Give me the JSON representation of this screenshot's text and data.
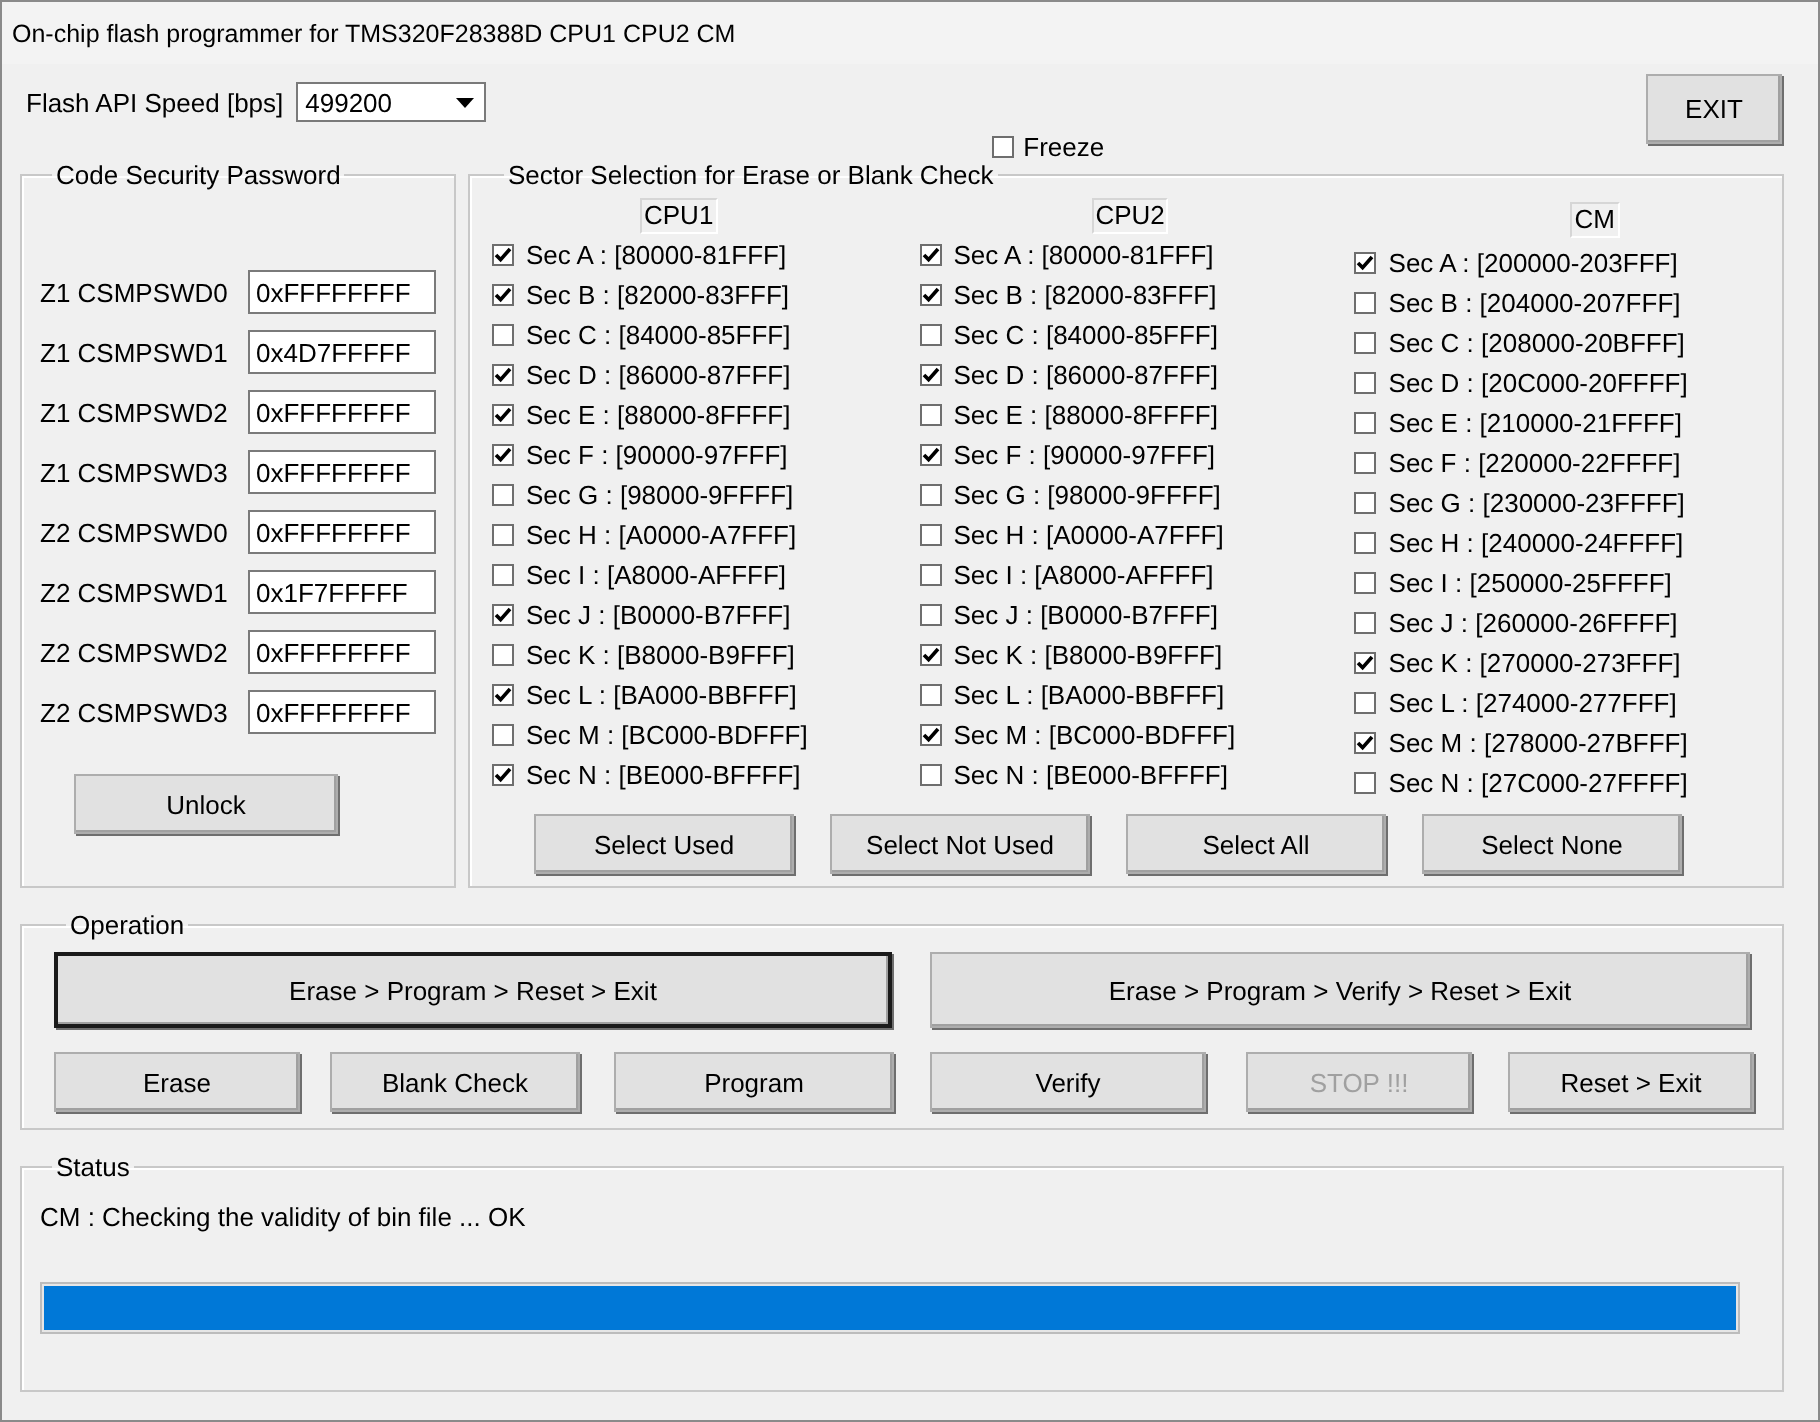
{
  "window": {
    "title": "On-chip flash programmer for TMS320F28388D CPU1 CPU2 CM"
  },
  "speed": {
    "label": "Flash API Speed [bps]",
    "value": "499200"
  },
  "freeze": {
    "label": "Freeze",
    "checked": false
  },
  "exit_button": "EXIT",
  "password": {
    "title": "Code Security Password",
    "fields": [
      {
        "label": "Z1 CSMPSWD0",
        "value": "0xFFFFFFFF"
      },
      {
        "label": "Z1 CSMPSWD1",
        "value": "0x4D7FFFFF"
      },
      {
        "label": "Z1 CSMPSWD2",
        "value": "0xFFFFFFFF"
      },
      {
        "label": "Z1 CSMPSWD3",
        "value": "0xFFFFFFFF"
      },
      {
        "label": "Z2 CSMPSWD0",
        "value": "0xFFFFFFFF"
      },
      {
        "label": "Z2 CSMPSWD1",
        "value": "0x1F7FFFFF"
      },
      {
        "label": "Z2 CSMPSWD2",
        "value": "0xFFFFFFFF"
      },
      {
        "label": "Z2 CSMPSWD3",
        "value": "0xFFFFFFFF"
      }
    ],
    "unlock_button": "Unlock"
  },
  "sectors": {
    "title": "Sector Selection for Erase or Blank Check",
    "columns": [
      {
        "name": "CPU1",
        "items": [
          {
            "label": "Sec A : [80000-81FFF]",
            "checked": true
          },
          {
            "label": "Sec B : [82000-83FFF]",
            "checked": true
          },
          {
            "label": "Sec C : [84000-85FFF]",
            "checked": false
          },
          {
            "label": "Sec D : [86000-87FFF]",
            "checked": true
          },
          {
            "label": "Sec E : [88000-8FFFF]",
            "checked": true
          },
          {
            "label": "Sec F : [90000-97FFF]",
            "checked": true
          },
          {
            "label": "Sec G : [98000-9FFFF]",
            "checked": false
          },
          {
            "label": "Sec H : [A0000-A7FFF]",
            "checked": false
          },
          {
            "label": "Sec I : [A8000-AFFFF]",
            "checked": false
          },
          {
            "label": "Sec J : [B0000-B7FFF]",
            "checked": true
          },
          {
            "label": "Sec K : [B8000-B9FFF]",
            "checked": false
          },
          {
            "label": "Sec L : [BA000-BBFFF]",
            "checked": true
          },
          {
            "label": "Sec M : [BC000-BDFFF]",
            "checked": false
          },
          {
            "label": "Sec N : [BE000-BFFFF]",
            "checked": true
          }
        ]
      },
      {
        "name": "CPU2",
        "items": [
          {
            "label": "Sec A : [80000-81FFF]",
            "checked": true
          },
          {
            "label": "Sec B : [82000-83FFF]",
            "checked": true
          },
          {
            "label": "Sec C : [84000-85FFF]",
            "checked": false
          },
          {
            "label": "Sec D : [86000-87FFF]",
            "checked": true
          },
          {
            "label": "Sec E : [88000-8FFFF]",
            "checked": false
          },
          {
            "label": "Sec F : [90000-97FFF]",
            "checked": true
          },
          {
            "label": "Sec G : [98000-9FFFF]",
            "checked": false
          },
          {
            "label": "Sec H : [A0000-A7FFF]",
            "checked": false
          },
          {
            "label": "Sec I : [A8000-AFFFF]",
            "checked": false
          },
          {
            "label": "Sec J : [B0000-B7FFF]",
            "checked": false
          },
          {
            "label": "Sec K : [B8000-B9FFF]",
            "checked": true
          },
          {
            "label": "Sec L : [BA000-BBFFF]",
            "checked": false
          },
          {
            "label": "Sec M : [BC000-BDFFF]",
            "checked": true
          },
          {
            "label": "Sec N : [BE000-BFFFF]",
            "checked": false
          }
        ]
      },
      {
        "name": "CM",
        "items": [
          {
            "label": "Sec A : [200000-203FFF]",
            "checked": true
          },
          {
            "label": "Sec B : [204000-207FFF]",
            "checked": false
          },
          {
            "label": "Sec C : [208000-20BFFF]",
            "checked": false
          },
          {
            "label": "Sec D : [20C000-20FFFF]",
            "checked": false
          },
          {
            "label": "Sec E : [210000-21FFFF]",
            "checked": false
          },
          {
            "label": "Sec F : [220000-22FFFF]",
            "checked": false
          },
          {
            "label": "Sec G : [230000-23FFFF]",
            "checked": false
          },
          {
            "label": "Sec H : [240000-24FFFF]",
            "checked": false
          },
          {
            "label": "Sec I : [250000-25FFFF]",
            "checked": false
          },
          {
            "label": "Sec J : [260000-26FFFF]",
            "checked": false
          },
          {
            "label": "Sec K : [270000-273FFF]",
            "checked": true
          },
          {
            "label": "Sec L : [274000-277FFF]",
            "checked": false
          },
          {
            "label": "Sec M : [278000-27BFFF]",
            "checked": true
          },
          {
            "label": "Sec N : [27C000-27FFFF]",
            "checked": false
          }
        ]
      }
    ],
    "buttons": [
      "Select Used",
      "Select Not Used",
      "Select All",
      "Select None"
    ]
  },
  "operation": {
    "title": "Operation",
    "main_buttons": [
      {
        "label": "Erase > Program > Reset > Exit",
        "default": true
      },
      {
        "label": "Erase > Program > Verify > Reset > Exit",
        "default": false
      }
    ],
    "buttons": [
      {
        "label": "Erase",
        "disabled": false
      },
      {
        "label": "Blank Check",
        "disabled": false
      },
      {
        "label": "Program",
        "disabled": false
      },
      {
        "label": "Verify",
        "disabled": false
      },
      {
        "label": "STOP !!!",
        "disabled": true
      },
      {
        "label": "Reset > Exit",
        "disabled": false
      }
    ]
  },
  "status": {
    "title": "Status",
    "message": "CM : Checking the validity of bin file ... OK",
    "progress": {
      "level": 1
    }
  }
}
